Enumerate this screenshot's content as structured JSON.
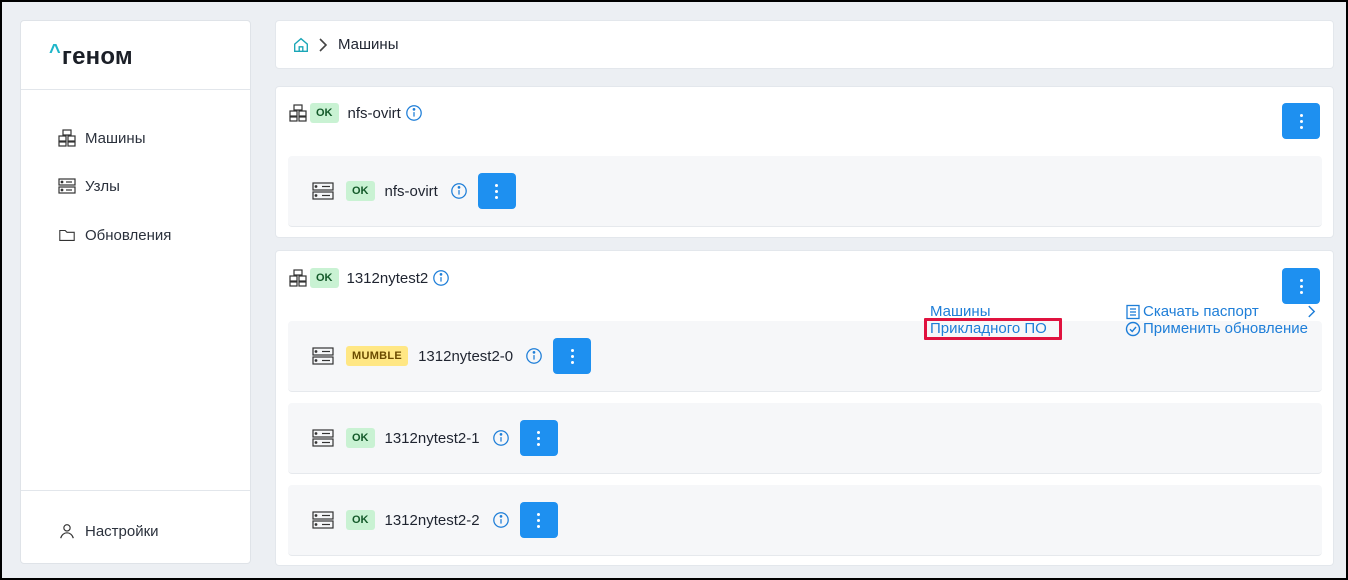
{
  "app": {
    "logo_text": "геном",
    "logo_caret": "^"
  },
  "sidebar": {
    "items": [
      {
        "label": "Машины",
        "icon": "machines-icon"
      },
      {
        "label": "Узлы",
        "icon": "server-icon"
      },
      {
        "label": "Обновления",
        "icon": "folder-icon"
      }
    ],
    "footer": {
      "label": "Настройки",
      "icon": "user-icon"
    }
  },
  "breadcrumb": {
    "home_icon": "home-icon",
    "current": "Машины"
  },
  "groups": [
    {
      "status": "OK",
      "name": "nfs-ovirt",
      "nodes": [
        {
          "status": "OK",
          "name": "nfs-ovirt"
        }
      ]
    },
    {
      "status": "OK",
      "name": "1312nytest2",
      "nodes": [
        {
          "status": "MUMBLE",
          "name": "1312nytest2-0"
        },
        {
          "status": "OK",
          "name": "1312nytest2-1"
        },
        {
          "status": "OK",
          "name": "1312nytest2-2"
        }
      ]
    }
  ],
  "context_menu": {
    "breadcrumb_link_1": "Машины",
    "breadcrumb_link_2": "Прикладного ПО",
    "download_passport": "Скачать паспорт",
    "apply_update": "Применить обновление"
  },
  "colors": {
    "accent": "#1e90f0",
    "ok_bg": "#c9f2d3",
    "warn_bg": "#ffe784",
    "highlight": "#e0123f",
    "logo_accent": "#1fb6c9"
  }
}
